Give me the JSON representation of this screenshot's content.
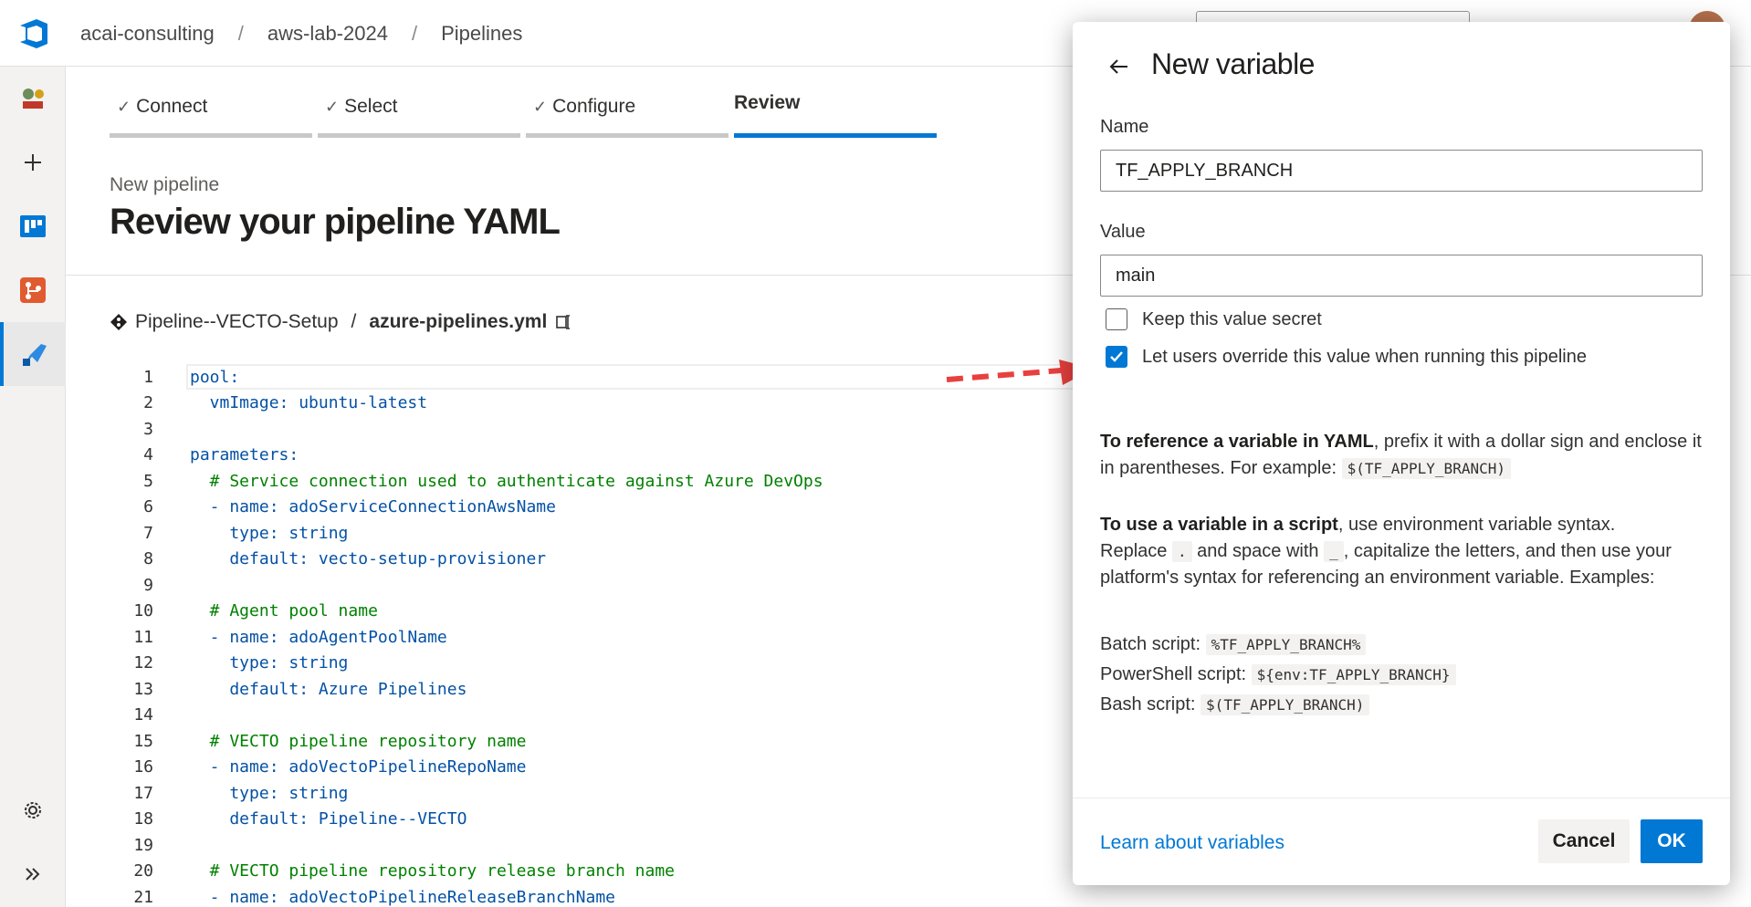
{
  "breadcrumb": {
    "org": "acai-consulting",
    "project": "aws-lab-2024",
    "section": "Pipelines"
  },
  "steps": [
    {
      "label": "Connect",
      "done": true
    },
    {
      "label": "Select",
      "done": true
    },
    {
      "label": "Configure",
      "done": true
    },
    {
      "label": "Review",
      "done": false
    }
  ],
  "page": {
    "subtitle": "New pipeline",
    "title": "Review your pipeline YAML",
    "repo": "Pipeline--VECTO-Setup",
    "file": "azure-pipelines.yml"
  },
  "code": [
    {
      "n": "1",
      "t": "pool:"
    },
    {
      "n": "2",
      "t": "  vmImage: ubuntu-latest"
    },
    {
      "n": "3",
      "t": ""
    },
    {
      "n": "4",
      "t": "parameters:"
    },
    {
      "n": "5",
      "t": "  # Service connection used to authenticate against Azure DevOps"
    },
    {
      "n": "6",
      "t": "  - name: adoServiceConnectionAwsName"
    },
    {
      "n": "7",
      "t": "    type: string"
    },
    {
      "n": "8",
      "t": "    default: vecto-setup-provisioner"
    },
    {
      "n": "9",
      "t": ""
    },
    {
      "n": "10",
      "t": "  # Agent pool name"
    },
    {
      "n": "11",
      "t": "  - name: adoAgentPoolName"
    },
    {
      "n": "12",
      "t": "    type: string"
    },
    {
      "n": "13",
      "t": "    default: Azure Pipelines"
    },
    {
      "n": "14",
      "t": ""
    },
    {
      "n": "15",
      "t": "  # VECTO pipeline repository name"
    },
    {
      "n": "16",
      "t": "  - name: adoVectoPipelineRepoName"
    },
    {
      "n": "17",
      "t": "    type: string"
    },
    {
      "n": "18",
      "t": "    default: Pipeline--VECTO"
    },
    {
      "n": "19",
      "t": ""
    },
    {
      "n": "20",
      "t": "  # VECTO pipeline repository release branch name"
    },
    {
      "n": "21",
      "t": "  - name: adoVectoPipelineReleaseBranchName"
    }
  ],
  "dialog": {
    "title": "New variable",
    "name_label": "Name",
    "name_value": "TF_APPLY_BRANCH",
    "value_label": "Value",
    "value_value": "main",
    "secret_label": "Keep this value secret",
    "secret_checked": false,
    "override_label": "Let users override this value when running this pipeline",
    "override_checked": true,
    "yaml_ref_bold": "To reference a variable in YAML",
    "yaml_ref_rest": ", prefix it with a dollar sign and enclose it in parentheses. For example: ",
    "yaml_ref_example": "$(TF_APPLY_BRANCH)",
    "script_bold": "To use a variable in a script",
    "script_rest1": ", use environment variable syntax.",
    "script_replace": "Replace ",
    "script_dot": ".",
    "script_and": " and space with ",
    "script_underscore": "_",
    "script_rest2": ", capitalize the letters, and then use your platform's syntax for referencing an environment variable. Examples:",
    "batch_label": "Batch script: ",
    "batch_value": "%TF_APPLY_BRANCH%",
    "ps_label": "PowerShell script: ",
    "ps_value": "${env:TF_APPLY_BRANCH}",
    "bash_label": "Bash script: ",
    "bash_value": "$(TF_APPLY_BRANCH)",
    "learn_link": "Learn about variables",
    "cancel": "Cancel",
    "ok": "OK"
  },
  "colors": {
    "accent": "#0078d4",
    "arrow": "#e8403f",
    "comment": "#008000",
    "keyword": "#0451a5"
  }
}
